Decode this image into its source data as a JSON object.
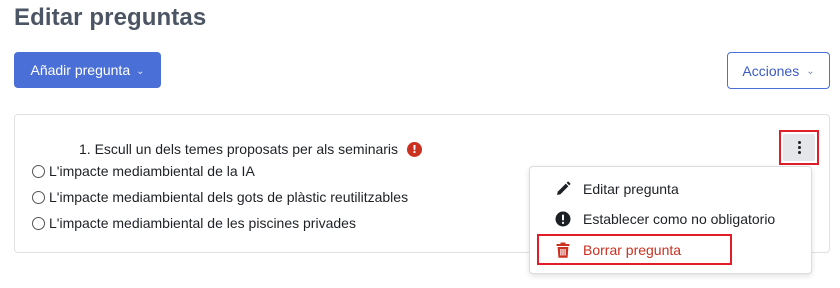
{
  "page": {
    "title": "Editar preguntas"
  },
  "toolbar": {
    "add_question_label": "Añadir pregunta",
    "actions_label": "Acciones"
  },
  "question": {
    "title": "1. Escull un dels temes proposats per als seminaris",
    "required_icon": "!",
    "options": [
      "L'impacte mediambiental de la IA",
      "L'impacte mediambiental dels gots de plàstic reutilitzables",
      "L'impacte mediambiental de les piscines privades"
    ]
  },
  "menu": {
    "items": [
      {
        "label": "Editar pregunta",
        "icon": "pencil-icon"
      },
      {
        "label": "Establecer como no obligatorio",
        "icon": "exclamation-circle-icon"
      },
      {
        "label": "Borrar pregunta",
        "icon": "trash-icon"
      }
    ]
  },
  "colors": {
    "primary": "#4a6fd6",
    "danger": "#ca3120",
    "highlight": "#e11d2a",
    "title": "#4b5563"
  }
}
